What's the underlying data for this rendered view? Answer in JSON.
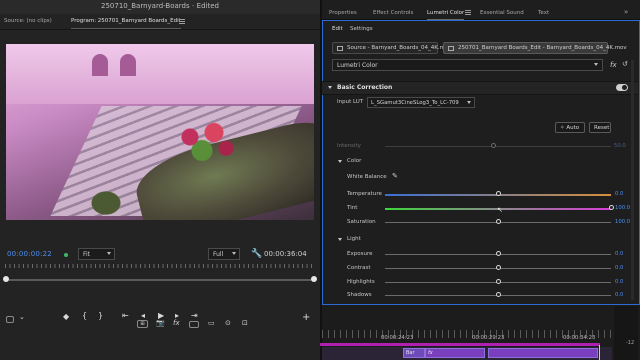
{
  "window": {
    "project": "250710_Barnyard-Boards",
    "separator": "-",
    "status": "Edited"
  },
  "monitor": {
    "source_tab": "Source: (no clips)",
    "program_tab": "Program: 250701_Barnyard Boards_Edit",
    "timecode_current": "00:00:00:22",
    "fit_select": "Fit",
    "quality_select": "Full",
    "timecode_duration": "00:00:36:04"
  },
  "panel_tabs": [
    "Properties",
    "Effect Controls",
    "Lumetri Color",
    "Essential Sound",
    "Text"
  ],
  "lumetri": {
    "clip_tabs": [
      "Source - Barnyard_Boards_04_4K.mov",
      "250701_Barnyard Boards_Edit - Barnyard_Boards_04_4K.mov"
    ],
    "effect_select": "Lumetri Color",
    "fx_label": "fx",
    "section_title": "Basic Correction",
    "input_lut_label": "Input LUT",
    "input_lut_value": "L_SGamut3CineSLog3_To_LC-709",
    "auto_button": "Auto",
    "reset_button": "Reset",
    "intensity": {
      "label": "Intensity",
      "value": "50.0"
    },
    "color_group": "Color",
    "white_balance_label": "White Balance",
    "temperature": {
      "label": "Temperature",
      "value": "0.0"
    },
    "tint": {
      "label": "Tint",
      "value": "100.0"
    },
    "saturation": {
      "label": "Saturation",
      "value": "100.0"
    },
    "light_group": "Light",
    "exposure": {
      "label": "Exposure",
      "value": "0.0"
    },
    "contrast": {
      "label": "Contrast",
      "value": "0.0"
    },
    "highlights": {
      "label": "Highlights",
      "value": "0.0"
    },
    "shadows": {
      "label": "Shadows",
      "value": "0.0"
    },
    "left_tab_labels": [
      "Edit",
      "Settings"
    ]
  },
  "timeline": {
    "times": [
      "00:00:24:23",
      "00:00:29:23",
      "00:00:34:23"
    ],
    "clip_labels": [
      "Bar",
      "fx"
    ],
    "meter_label": "-12"
  },
  "colors": {
    "accent": "#4d8ff0",
    "panel_focus": "#2d6ad6",
    "clip": "#6d4bb8"
  }
}
